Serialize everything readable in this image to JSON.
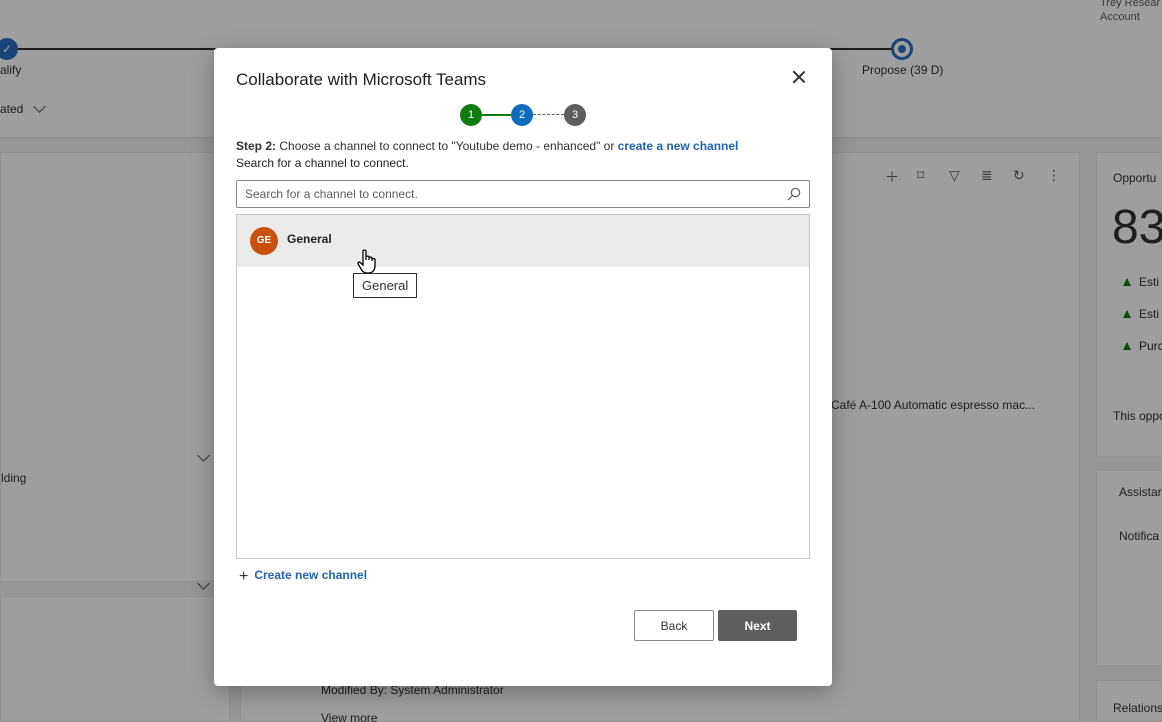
{
  "background": {
    "account_name": "Trey Resear",
    "account_type": "Account",
    "bpf_stage_left": "alify",
    "bpf_stage_active": "Propose",
    "bpf_stage_active_duration": "(39 D)",
    "filter_label": "ated",
    "building_text": "lding",
    "product_text": "Café A-100 Automatic espresso mac...",
    "opportunity_label": "Opportu",
    "big_number": "83",
    "estimate_1": "Esti",
    "estimate_2": "Esti",
    "purchase": "Purc",
    "this_opp": "This oppo",
    "assistant": "Assistar",
    "notifications": "Notifica",
    "modified_by": "Modified By: System Administrator",
    "view_more": "View more",
    "relations": "Relations"
  },
  "dialog": {
    "title": "Collaborate with Microsoft Teams",
    "steps": [
      "1",
      "2",
      "3"
    ],
    "current_step": 2,
    "step_prefix": "Step 2:",
    "step_text": " Choose a channel to connect to \"Youtube demo - enhanced\" or ",
    "step_link": "create a new channel",
    "search_instruction": "Search for a channel to connect.",
    "search_placeholder": "Search for a channel to connect.",
    "channels": [
      {
        "initials": "GE",
        "name": "General"
      }
    ],
    "tooltip": "General",
    "create_channel_label": "Create new channel",
    "back_label": "Back",
    "next_label": "Next"
  },
  "colors": {
    "step_complete": "#107c10",
    "step_current": "#0f6cbd",
    "step_pending": "#605e5c",
    "avatar": "#ca5010",
    "link": "#2264b0",
    "next_button": "#605e5c"
  },
  "icons": {
    "close": "close-icon",
    "search": "search-icon",
    "add": "plus-icon",
    "cursor": "hand-cursor-icon"
  }
}
